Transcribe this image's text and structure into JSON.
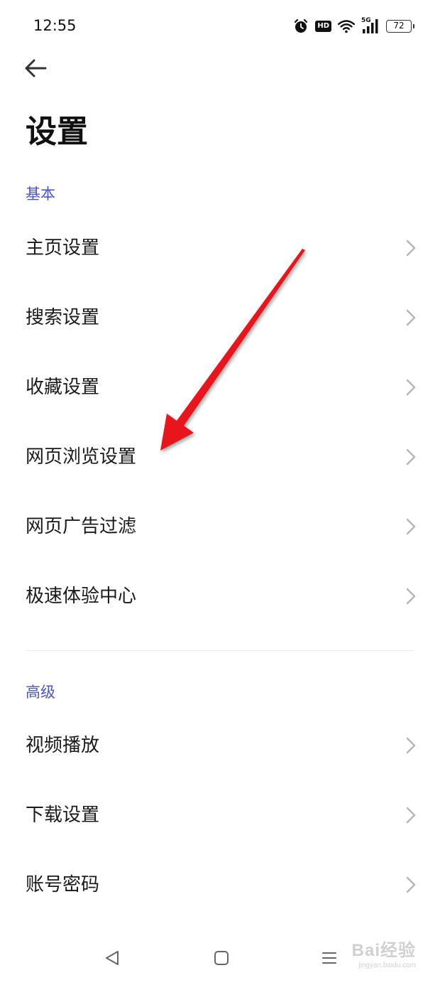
{
  "status_bar": {
    "time": "12:55",
    "network_label": "5G",
    "hd_label": "HD",
    "battery_level": "72",
    "icons": [
      "alarm-icon",
      "hd-icon",
      "wifi-icon",
      "cellular-signal-icon",
      "battery-icon"
    ]
  },
  "header": {
    "back_icon": "arrow-left-icon",
    "title": "设置"
  },
  "sections": {
    "basic": {
      "header": "基本",
      "items": [
        {
          "label": "主页设置"
        },
        {
          "label": "搜索设置"
        },
        {
          "label": "收藏设置"
        },
        {
          "label": "网页浏览设置"
        },
        {
          "label": "网页广告过滤"
        },
        {
          "label": "极速体验中心"
        }
      ]
    },
    "advanced": {
      "header": "高级",
      "items": [
        {
          "label": "视频播放"
        },
        {
          "label": "下载设置"
        },
        {
          "label": "账号密码"
        }
      ]
    }
  },
  "nav_bar": {
    "icons": [
      "back-triangle-icon",
      "home-square-icon",
      "recents-menu-icon"
    ]
  },
  "watermark": {
    "text": "Bai经验",
    "subtext": "jingyan.baidu.com"
  },
  "colors": {
    "accent": "#4a55c7",
    "annotation_arrow": "#e8131b",
    "chevron": "#b5b5b5",
    "text": "#1a1a1a"
  }
}
